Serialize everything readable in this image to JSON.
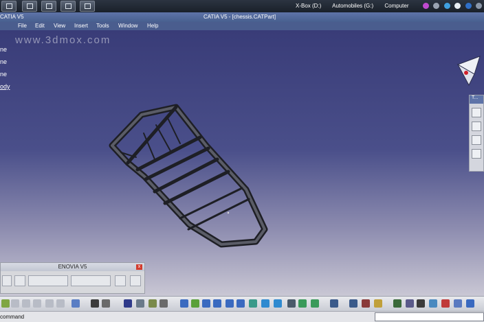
{
  "taskbar": {
    "drives": [
      "X-Box (D:)",
      "Automobiles (G:)",
      "Computer"
    ]
  },
  "window": {
    "left_label": "CATIA V5",
    "title": "CATIA V5 - [chessis.CATPart]"
  },
  "menu": [
    "File",
    "Edit",
    "View",
    "Insert",
    "Tools",
    "Window",
    "Help"
  ],
  "watermark": "www.3dmox.com",
  "tree": [
    "ne",
    "ne",
    "ne",
    "ody"
  ],
  "enovia": {
    "title": "ENOVIA V5",
    "close": "x"
  },
  "right_toolbar": {
    "title": "T..."
  },
  "status": {
    "message": "command",
    "input_value": ""
  }
}
